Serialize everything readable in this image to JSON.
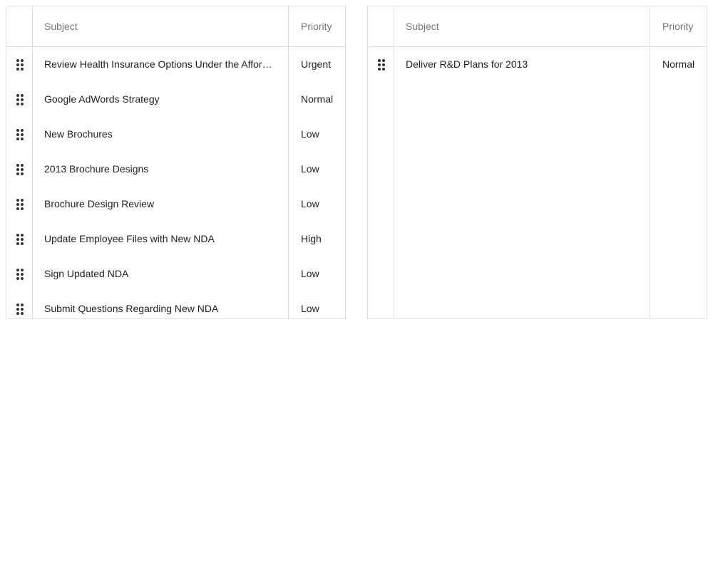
{
  "left_grid": {
    "columns": {
      "subject": "Subject",
      "priority": "Priority"
    },
    "rows": [
      {
        "subject": "Review Health Insurance Options Under the Affordable Care Act",
        "priority": "Urgent"
      },
      {
        "subject": "Google AdWords Strategy",
        "priority": "Normal"
      },
      {
        "subject": "New Brochures",
        "priority": "Low"
      },
      {
        "subject": "2013 Brochure Designs",
        "priority": "Low"
      },
      {
        "subject": "Brochure Design Review",
        "priority": "Low"
      },
      {
        "subject": "Update Employee Files with New NDA",
        "priority": "High"
      },
      {
        "subject": "Sign Updated NDA",
        "priority": "Low"
      },
      {
        "subject": "Submit Questions Regarding New NDA",
        "priority": "Low"
      }
    ]
  },
  "right_grid": {
    "columns": {
      "subject": "Subject",
      "priority": "Priority"
    },
    "rows": [
      {
        "subject": "Deliver R&D Plans for 2013",
        "priority": "Normal"
      }
    ]
  },
  "icons": {
    "drag_handle": "drag-handle-icon"
  },
  "colors": {
    "border": "#dddddd",
    "header_text": "#767676",
    "cell_text": "#212121"
  }
}
